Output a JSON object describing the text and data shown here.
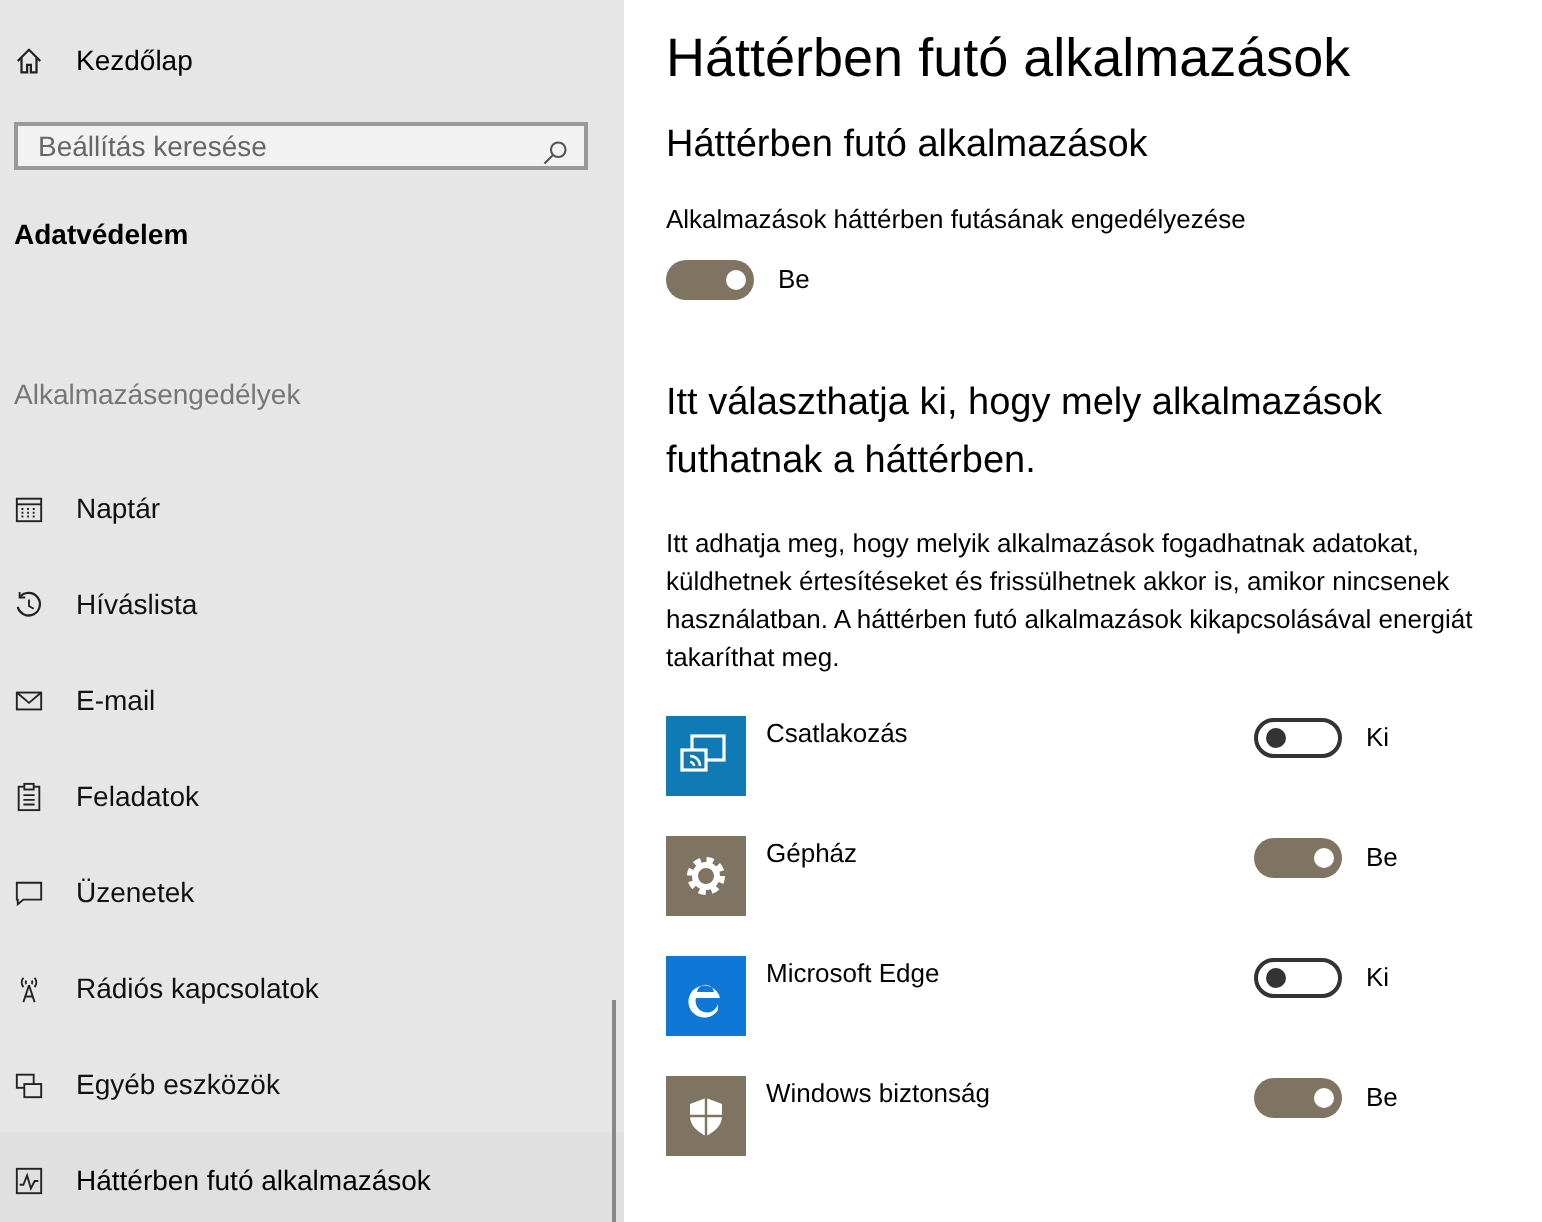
{
  "sidebar": {
    "home": "Kezdőlap",
    "search": {
      "placeholder": "Beállítás keresése"
    },
    "section": "Adatvédelem",
    "group": "Alkalmazásengedélyek",
    "items": [
      {
        "label": "Naptár",
        "kind": "calendar",
        "selected": false
      },
      {
        "label": "Híváslista",
        "kind": "history",
        "selected": false
      },
      {
        "label": "E-mail",
        "kind": "mail",
        "selected": false
      },
      {
        "label": "Feladatok",
        "kind": "tasks",
        "selected": false
      },
      {
        "label": "Üzenetek",
        "kind": "message",
        "selected": false
      },
      {
        "label": "Rádiós kapcsolatok",
        "kind": "radio",
        "selected": false
      },
      {
        "label": "Egyéb eszközök",
        "kind": "devices",
        "selected": false
      },
      {
        "label": "Háttérben futó alkalmazások",
        "kind": "activity",
        "selected": true
      }
    ]
  },
  "page": {
    "title": "Háttérben futó alkalmazások",
    "subtitle": "Háttérben futó alkalmazások",
    "master": {
      "label": "Alkalmazások háttérben futásának engedélyezése",
      "on": true,
      "state": "Be"
    },
    "heading": "Itt választhatja ki, hogy mely alkalmazások futhatnak a háttérben.",
    "description": "Itt adhatja meg, hogy melyik alkalmazások fogadhatnak adatokat, küldhetnek értesítéseket és frissülhetnek akkor is, amikor nincsenek használatban. A háttérben futó alkalmazások kikapcsolásával energiát takaríthat meg.",
    "apps": [
      {
        "name": "Csatlakozás",
        "kind": "connect",
        "color": "#0f7ab4",
        "on": false,
        "state": "Ki"
      },
      {
        "name": "Gépház",
        "kind": "gear",
        "color": "#7f7461",
        "on": true,
        "state": "Be"
      },
      {
        "name": "Microsoft Edge",
        "kind": "edge",
        "color": "#0f78d7",
        "on": false,
        "state": "Ki"
      },
      {
        "name": "Windows biztonság",
        "kind": "shield",
        "color": "#7f7461",
        "on": true,
        "state": "Be"
      }
    ]
  }
}
